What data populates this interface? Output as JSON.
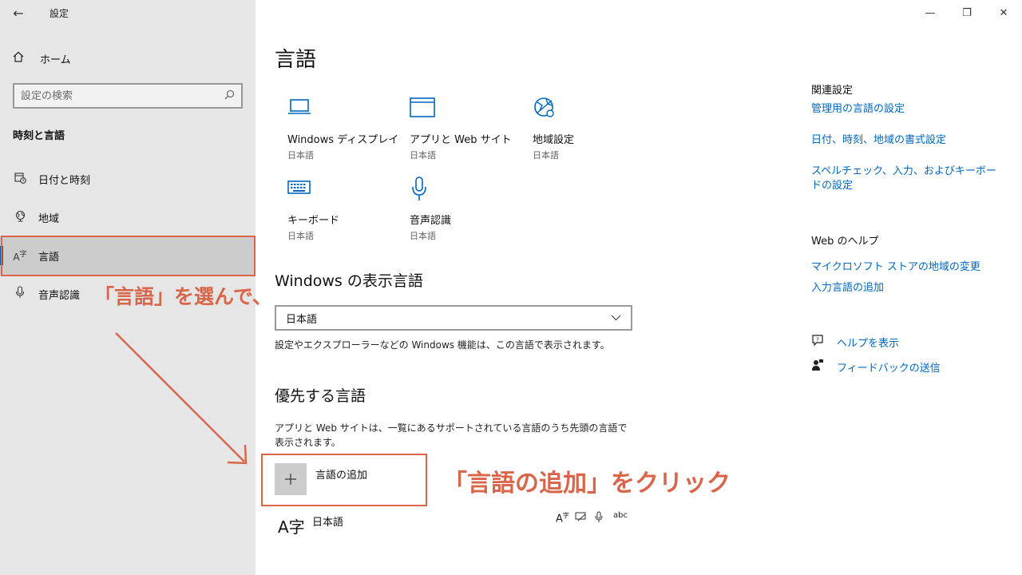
{
  "window": {
    "title": "設定",
    "back_icon": "arrow-left-icon"
  },
  "sidebar": {
    "home_label": "ホーム",
    "search_placeholder": "設定の検索",
    "section": "時刻と言語",
    "items": [
      {
        "label": "日付と時刻",
        "icon": "calendar-clock-icon"
      },
      {
        "label": "地域",
        "icon": "globe-icon"
      },
      {
        "label": "言語",
        "icon": "language-icon",
        "selected": true
      },
      {
        "label": "音声認識",
        "icon": "microphone-icon"
      }
    ]
  },
  "annotations": {
    "select_note": "「言語」を選んで、",
    "click_note": "「言語の追加」をクリック",
    "color": "#d9664a"
  },
  "main": {
    "title": "言語",
    "tiles": [
      {
        "title": "Windows ディスプレイ",
        "sub": "日本語",
        "icon": "laptop-icon"
      },
      {
        "title": "アプリと Web サイト",
        "sub": "日本語",
        "icon": "browser-window-icon"
      },
      {
        "title": "地域設定",
        "sub": "日本語",
        "icon": "globe-settings-icon"
      },
      {
        "title": "キーボード",
        "sub": "日本語",
        "icon": "keyboard-icon"
      },
      {
        "title": "音声認識",
        "sub": "日本語",
        "icon": "microphone-icon"
      }
    ],
    "display_lang": {
      "heading": "Windows の表示言語",
      "value": "日本語",
      "desc": "設定やエクスプローラーなどの Windows 機能は、この言語で表示されます。"
    },
    "preferred": {
      "heading": "優先する言語",
      "desc": "アプリと Web サイトは、一覧にあるサポートされている言語のうち先頭の言語で表示されます。",
      "add_label": "言語の追加",
      "lang_glyph": "A字",
      "lang_name": "日本語"
    }
  },
  "related": {
    "heading": "関連設定",
    "links": [
      "管理用の言語の設定",
      "日付、時刻、地域の書式設定",
      "スペルチェック、入力、およびキーボードの設定"
    ]
  },
  "help": {
    "heading": "Web のヘルプ",
    "links": [
      "マイクロソフト ストアの地域の変更",
      "入力言語の追加"
    ],
    "show_help": "ヘルプを表示",
    "feedback": "フィードバックの送信"
  },
  "accent_color": "#0067c0"
}
